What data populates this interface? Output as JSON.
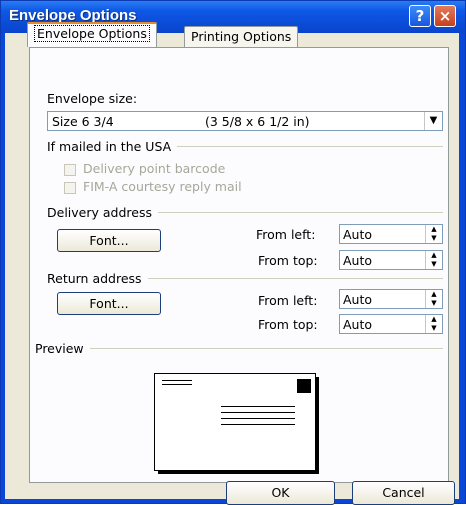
{
  "window": {
    "title": "Envelope Options",
    "help_glyph": "?",
    "close_glyph": "×"
  },
  "tabs": {
    "active": "Envelope Options",
    "inactive": "Printing Options"
  },
  "envelope_size": {
    "label": "Envelope size:",
    "selected_name": "Size 6 3/4",
    "selected_dims": "(3 5/8 x 6 1/2 in)"
  },
  "usa": {
    "group": "If mailed in the USA",
    "barcode_label": "Delivery point barcode",
    "fim_label": "FIM-A courtesy reply mail"
  },
  "delivery": {
    "group": "Delivery address",
    "font_button": "Font...",
    "from_left_label": "From left:",
    "from_left_value": "Auto",
    "from_top_label": "From top:",
    "from_top_value": "Auto"
  },
  "return": {
    "group": "Return address",
    "font_button": "Font...",
    "from_left_label": "From left:",
    "from_left_value": "Auto",
    "from_top_label": "From top:",
    "from_top_value": "Auto"
  },
  "preview": {
    "group": "Preview"
  },
  "buttons": {
    "ok": "OK",
    "cancel": "Cancel"
  },
  "colors": {
    "titlebar": "#0a4cd8",
    "face": "#ece9d8",
    "panel": "#fcfcfe",
    "close": "#c4401e",
    "tab_accent": "#e68b2c"
  }
}
